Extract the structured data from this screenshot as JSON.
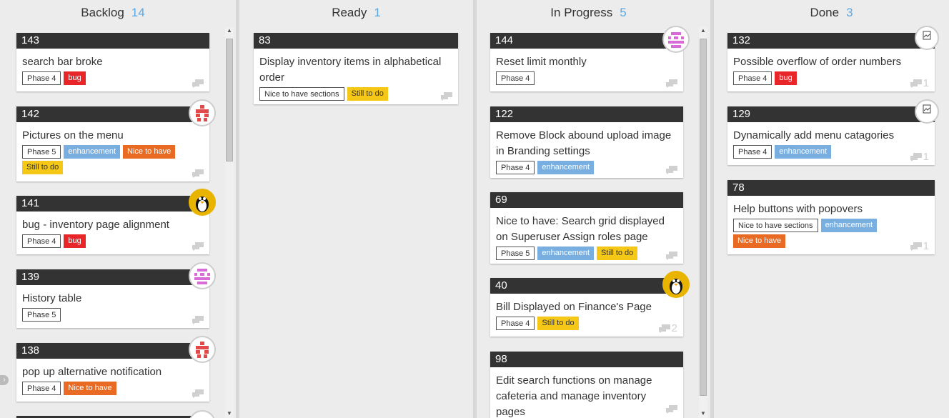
{
  "columns": {
    "backlog": {
      "title": "Backlog",
      "count": "14"
    },
    "ready": {
      "title": "Ready",
      "count": "1"
    },
    "in_progress": {
      "title": "In Progress",
      "count": "5"
    },
    "done": {
      "title": "Done",
      "count": "3"
    }
  },
  "cards": {
    "c143": {
      "id": "143",
      "title": "search bar broke",
      "tags": [
        "Phase 4",
        "bug"
      ]
    },
    "c142": {
      "id": "142",
      "title": "Pictures on the menu",
      "tags": [
        "Phase 5",
        "enhancement",
        "Nice to have",
        "Still to do"
      ]
    },
    "c141": {
      "id": "141",
      "title": "bug - inventory page alignment",
      "tags": [
        "Phase 4",
        "bug"
      ]
    },
    "c139": {
      "id": "139",
      "title": "History table",
      "tags": [
        "Phase 5"
      ]
    },
    "c138": {
      "id": "138",
      "title": "pop up alternative notification",
      "tags": [
        "Phase 4",
        "Nice to have"
      ]
    },
    "c83": {
      "id": "83",
      "title": "Display inventory items in alphabetical order",
      "tags": [
        "Nice to have sections",
        "Still to do"
      ]
    },
    "c144": {
      "id": "144",
      "title": "Reset limit monthly",
      "tags": [
        "Phase 4"
      ]
    },
    "c122": {
      "id": "122",
      "title": "Remove Block abound upload image in Branding settings",
      "tags": [
        "Phase 4",
        "enhancement"
      ]
    },
    "c69": {
      "id": "69",
      "title": "Nice to have: Search grid displayed on Superuser Assign roles page",
      "tags": [
        "Phase 5",
        "enhancement",
        "Still to do"
      ]
    },
    "c40": {
      "id": "40",
      "title": "Bill Displayed on Finance's Page",
      "tags": [
        "Phase 4",
        "Still to do"
      ],
      "comments": "2"
    },
    "c98": {
      "id": "98",
      "title": "Edit search functions on manage cafeteria and manage inventory pages",
      "tags": []
    },
    "c132": {
      "id": "132",
      "title": "Possible overflow of order numbers",
      "tags": [
        "Phase 4",
        "bug"
      ],
      "comments": "1"
    },
    "c129": {
      "id": "129",
      "title": "Dynamically add menu catagories",
      "tags": [
        "Phase 4",
        "enhancement"
      ],
      "comments": "1"
    },
    "c78": {
      "id": "78",
      "title": "Help buttons with popovers",
      "tags": [
        "Nice to have sections",
        "enhancement",
        "Nice to have"
      ],
      "comments": "1"
    }
  },
  "icons": {
    "comment": "comment-icon",
    "avatar_red": "avatar-red-pixel-icon",
    "avatar_pink": "avatar-pink-pixel-icon",
    "avatar_penguin": "avatar-penguin-icon",
    "avatar_broken": "avatar-broken-image-icon"
  },
  "colors": {
    "bug": "#e8262a",
    "enhancement": "#79aee0",
    "nice_to_have": "#e96a23",
    "still_to_do": "#f5c817",
    "count": "#5aa9e6",
    "card_header": "#333333"
  }
}
